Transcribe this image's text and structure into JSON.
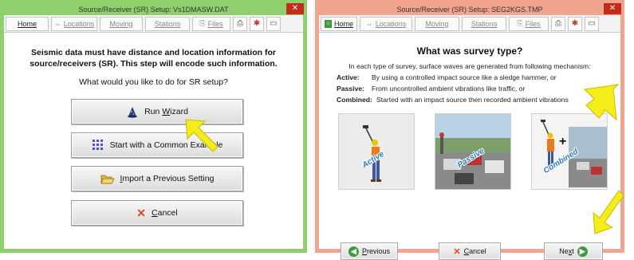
{
  "colors": {
    "left_border": "#8fd06d",
    "right_border": "#f2a48e",
    "close": "#c42b1c",
    "arrow_yellow": "#f5ec1c",
    "accent_green": "#3a9c3a",
    "cancel_red": "#e04a1a"
  },
  "toolbar": {
    "home": "Home",
    "locations": "Locations",
    "moving": "Moving",
    "stations": "Stations",
    "files": "Files",
    "icons": [
      "print-icon",
      "settings-icon",
      "window-icon"
    ]
  },
  "window1": {
    "title": "Source/Receiver (SR) Setup: Vs1DMASW.DAT",
    "close": "✕",
    "intro": "Seismic data must have distance and location information for source/receivers (SR).  This step will encode such information.",
    "question": "What would you like to do for SR setup?",
    "buttons": {
      "wizard": {
        "pre": "Run ",
        "ul": "W",
        "post": "izard",
        "icon": "wizard-hat-icon"
      },
      "example": {
        "pre": "Start with a Common Ex",
        "ul": "",
        "post": "ample",
        "icon": "grid-icon"
      },
      "import": {
        "pre": "",
        "ul": "I",
        "post": "mport a Previous Setting",
        "icon": "open-folder-icon"
      },
      "cancel": {
        "pre": "",
        "ul": "C",
        "post": "ancel",
        "icon": "cancel-x-icon"
      }
    }
  },
  "window2": {
    "title": "Source/Receiver (SR) Setup: SEG2KGS.TMP",
    "close": "✕",
    "heading": "What was survey type?",
    "description": "In each type of survey, surface waves are generated from following mechanism:",
    "definitions": [
      {
        "term": "Active:",
        "text": "By using a controlled impact source like a sledge hammer, or"
      },
      {
        "term": "Passive:",
        "text": "From uncontrolled ambient vibrations like traffic, or"
      },
      {
        "term": "Combined:",
        "text": "Started with an impact source then recorded ambient vibrations"
      }
    ],
    "images": [
      {
        "label": "Active"
      },
      {
        "label": "Passive"
      },
      {
        "label": "Combined",
        "plus": "+"
      }
    ],
    "nav": {
      "previous": {
        "ul": "P",
        "post": "revious"
      },
      "cancel": {
        "ul": "C",
        "post": "ancel"
      },
      "next": {
        "pre": "Ne",
        "ul": "x",
        "post": "t"
      }
    }
  }
}
